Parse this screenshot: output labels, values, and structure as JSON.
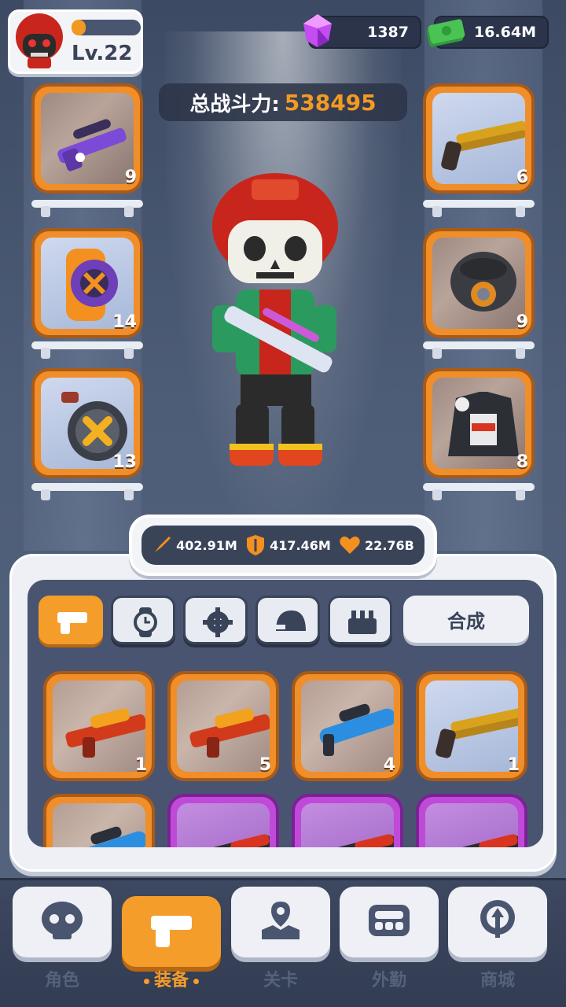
{
  "player": {
    "level": "Lv.22",
    "xp_fraction": 0.2
  },
  "resources": {
    "gems": "1387",
    "cash": "16.64M"
  },
  "power": {
    "label": "总战斗力:",
    "value": "538495"
  },
  "equipped_left": [
    {
      "name": "purple-sniper-rifle",
      "count": "9"
    },
    {
      "name": "watch-gadget",
      "count": "14"
    },
    {
      "name": "drum-magazine",
      "count": "13"
    }
  ],
  "equipped_right": [
    {
      "name": "gold-double-shotgun",
      "count": "6"
    },
    {
      "name": "gas-mask-helmet",
      "count": "9"
    },
    {
      "name": "racing-jacket",
      "count": "8"
    }
  ],
  "stats": {
    "attack": "402.91M",
    "defense": "417.46M",
    "health": "22.76B"
  },
  "tabs": [
    "weapon",
    "watch",
    "gear",
    "helmet",
    "armor"
  ],
  "merge_label": "合成",
  "inventory": [
    {
      "name": "dragon-rifle",
      "count": "1",
      "rarity": "orange"
    },
    {
      "name": "dragon-rifle",
      "count": "5",
      "rarity": "orange"
    },
    {
      "name": "blue-launcher",
      "count": "4",
      "rarity": "orange"
    },
    {
      "name": "gold-double-shotgun",
      "count": "1",
      "rarity": "orange"
    },
    {
      "name": "blue-launcher",
      "count": "",
      "rarity": "orange"
    },
    {
      "name": "red-shotgun",
      "count": "",
      "rarity": "purple"
    },
    {
      "name": "red-shotgun",
      "count": "",
      "rarity": "purple"
    },
    {
      "name": "red-shotgun",
      "count": "",
      "rarity": "purple"
    }
  ],
  "nav": [
    {
      "label": "角色",
      "icon": "skull-icon"
    },
    {
      "label": "装备",
      "icon": "gun-icon"
    },
    {
      "label": "关卡",
      "icon": "map-pin-icon"
    },
    {
      "label": "外勤",
      "icon": "gamepad-icon"
    },
    {
      "label": "商城",
      "icon": "shop-icon"
    }
  ],
  "colors": {
    "accent": "#f59d2a",
    "panel": "#495570",
    "rare_purple": "#c04ad8"
  }
}
